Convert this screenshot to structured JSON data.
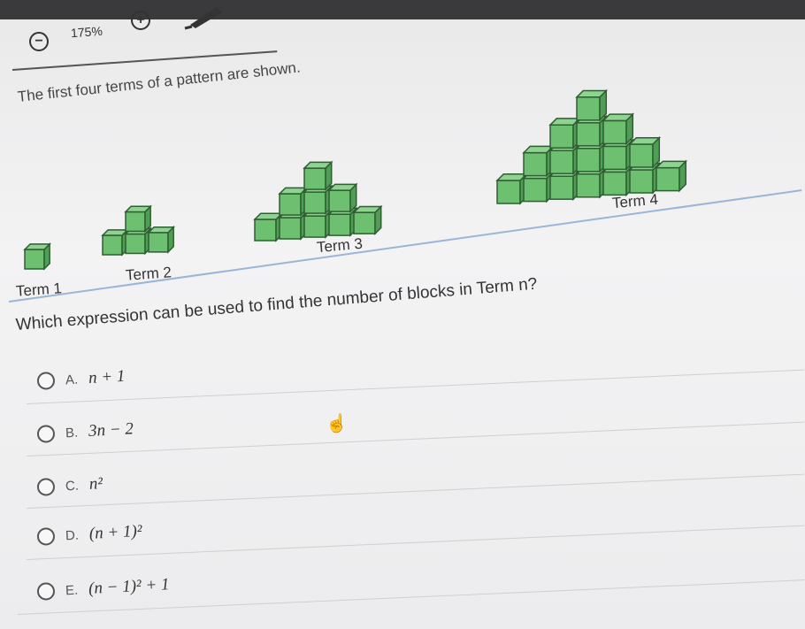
{
  "toolbar": {
    "zoom_out_symbol": "−",
    "zoom_level": "175%",
    "zoom_in_symbol": "+",
    "pen_icon": "pen-icon",
    "colors": {
      "band": "#3a3a3c"
    }
  },
  "problem": {
    "prompt": "The first four terms of a pattern are shown.",
    "terms": [
      {
        "label": "Term 1",
        "blocks": 1
      },
      {
        "label": "Term 2",
        "blocks": 4
      },
      {
        "label": "Term 3",
        "blocks": 9
      },
      {
        "label": "Term 4",
        "blocks": 16
      }
    ],
    "block_color": "#6cc070",
    "question": "Which expression can be used to find the number of blocks in Term n?",
    "choices": [
      {
        "letter": "A.",
        "expression": "n + 1"
      },
      {
        "letter": "B.",
        "expression": "3n − 2"
      },
      {
        "letter": "C.",
        "expression": "n²"
      },
      {
        "letter": "D.",
        "expression": "(n + 1)²"
      },
      {
        "letter": "E.",
        "expression": "(n − 1)² + 1"
      }
    ]
  }
}
